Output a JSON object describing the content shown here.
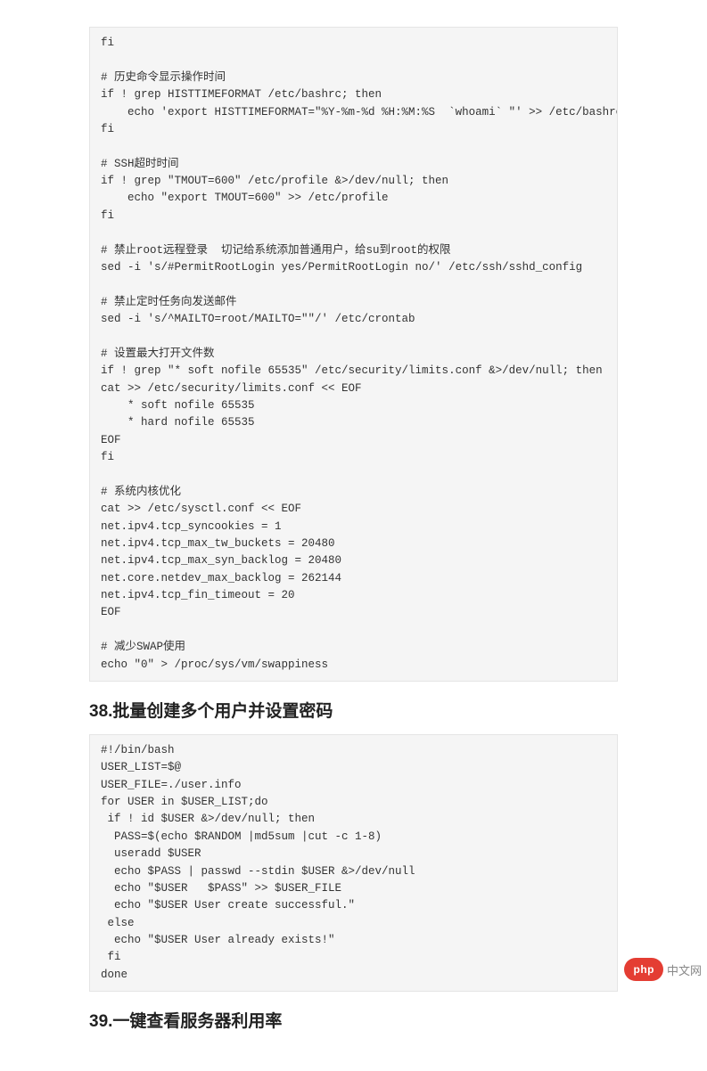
{
  "code_block_1": "fi\n\n# 历史命令显示操作时间\nif ! grep HISTTIMEFORMAT /etc/bashrc; then\n    echo 'export HISTTIMEFORMAT=\"%Y-%m-%d %H:%M:%S  `whoami` \"' >> /etc/bashrc\nfi\n\n# SSH超时时间\nif ! grep \"TMOUT=600\" /etc/profile &>/dev/null; then\n    echo \"export TMOUT=600\" >> /etc/profile\nfi\n\n# 禁止root远程登录  切记给系统添加普通用户，给su到root的权限\nsed -i 's/#PermitRootLogin yes/PermitRootLogin no/' /etc/ssh/sshd_config\n\n# 禁止定时任务向发送邮件\nsed -i 's/^MAILTO=root/MAILTO=\"\"/' /etc/crontab\n\n# 设置最大打开文件数\nif ! grep \"* soft nofile 65535\" /etc/security/limits.conf &>/dev/null; then\ncat >> /etc/security/limits.conf << EOF\n    * soft nofile 65535\n    * hard nofile 65535\nEOF\nfi\n\n# 系统内核优化\ncat >> /etc/sysctl.conf << EOF\nnet.ipv4.tcp_syncookies = 1\nnet.ipv4.tcp_max_tw_buckets = 20480\nnet.ipv4.tcp_max_syn_backlog = 20480\nnet.core.netdev_max_backlog = 262144\nnet.ipv4.tcp_fin_timeout = 20\nEOF\n\n# 减少SWAP使用\necho \"0\" > /proc/sys/vm/swappiness",
  "heading_38": "38.批量创建多个用户并设置密码",
  "code_block_2": "#!/bin/bash\nUSER_LIST=$@\nUSER_FILE=./user.info\nfor USER in $USER_LIST;do\n if ! id $USER &>/dev/null; then\n  PASS=$(echo $RANDOM |md5sum |cut -c 1-8)\n  useradd $USER\n  echo $PASS | passwd --stdin $USER &>/dev/null\n  echo \"$USER   $PASS\" >> $USER_FILE\n  echo \"$USER User create successful.\"\n else\n  echo \"$USER User already exists!\"\n fi\ndone",
  "heading_39": "39.一键查看服务器利用率",
  "watermark": {
    "badge": "php",
    "text": "中文网"
  }
}
